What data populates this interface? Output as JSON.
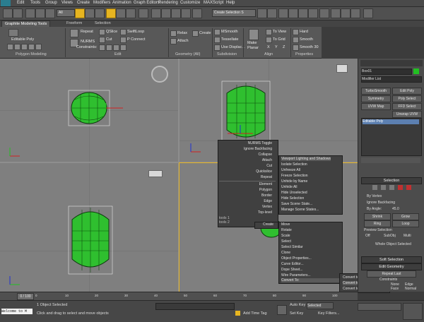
{
  "menu": [
    "Edit",
    "Tools",
    "Group",
    "Views",
    "Create",
    "Modifiers",
    "Animation",
    "Graph Editors",
    "Rendering",
    "Customize",
    "MAXScript",
    "Help"
  ],
  "toolbar": {
    "selection_set": "Create Selection S",
    "view_select": "All"
  },
  "ribbon": {
    "tabs": [
      "Graphite Modeling Tools",
      "Freeform",
      "Selection"
    ],
    "polymod": {
      "label": "Editable Poly",
      "group": "Polygon Modeling"
    },
    "edit": {
      "items": [
        "Repeat",
        "NURMS",
        "QSlice",
        "Cut",
        "SwiftLoop",
        "P Connect"
      ],
      "constraints_label": "Constraints:",
      "group": "Edit"
    },
    "geometry": {
      "items": [
        "Relax",
        "Attach",
        "Create"
      ],
      "group": "Geometry (All)"
    },
    "subdiv": {
      "items": [
        "MSmooth",
        "Tessellate",
        "Use Displac..."
      ],
      "group": "Subdivision"
    },
    "align": {
      "make_planar": "Make Planar",
      "items": [
        "To View",
        "To Grid"
      ],
      "xyz": [
        "X",
        "Y",
        "Z"
      ],
      "group": "Align"
    },
    "props": {
      "items": [
        "Hard",
        "Smooth",
        "Smooth 30"
      ],
      "group": "Properties"
    }
  },
  "quad": {
    "left_top": [
      "NURMS Toggle",
      "Ignore Backfacing",
      "Collapse",
      "Attach",
      "Cut",
      "Quickslice",
      "Repeat"
    ],
    "left_bottom": [
      "Element",
      "Polygon",
      "Border",
      "Edge",
      "Vertex",
      "Top-level"
    ],
    "left_tags": [
      "tools 1",
      "tools 2"
    ],
    "right_top": [
      "Viewport Lighting and Shadows",
      "Isolate Selection",
      "Unfreeze All",
      "Freeze Selection",
      "Unhide by Name",
      "Unhide All",
      "Hide Unselected",
      "Hide Selection",
      "Save Scene State...",
      "Manage Scene States..."
    ],
    "create_label": "Create",
    "right_bottom": [
      "Move",
      "Rotate",
      "Scale",
      "Select",
      "Select Similar",
      "Clone",
      "Object Properties...",
      "Curve Editor...",
      "Dope Sheet...",
      "Wire Parameters...",
      "Convert To:"
    ],
    "convert": [
      "Convert to Editable Mesh",
      "Convert to Editable Poly",
      "Convert to Editable Patch"
    ]
  },
  "cmd": {
    "object_name": "Box01",
    "modifier_list": "Modifier List",
    "buttons": [
      "TurboSmooth",
      "Edit Poly",
      "Symmetry",
      "Poly Select",
      "UVW Map",
      "FFD Select",
      "Unwrap UVW"
    ],
    "stack_item": "Editable Poly",
    "selection_head": "Selection",
    "by_vertex": "By Vertex",
    "ignore_backfacing": "Ignore Backfacing",
    "by_angle": "By Angle:",
    "angle_value": "45.0",
    "shrink": "Shrink",
    "grow": "Grow",
    "ring": "Ring",
    "loop": "Loop",
    "preview_label": "Preview Selection",
    "preview_opts": [
      "Off",
      "SubObj",
      "Multi"
    ],
    "whole_object": "Whole Object Selected",
    "soft_selection": "Soft Selection",
    "edit_geometry": "Edit Geometry",
    "repeat_last": "Repeat Last",
    "constraints": "Constraints",
    "none": "None",
    "edge": "Edge",
    "face": "Face",
    "normal": "Normal"
  },
  "timeline": {
    "frame": "0 / 100",
    "ticks": [
      "0",
      "10",
      "20",
      "30",
      "40",
      "50",
      "60",
      "70",
      "80",
      "90",
      "100"
    ]
  },
  "status": {
    "script_listener": "Welcome to M",
    "selected": "1 Object Selected",
    "prompt": "Click and drag to select and move objects",
    "add_time_tag": "Add Time Tag",
    "auto_key": "Auto Key",
    "selected_btn": "Selected",
    "set_key": "Set Key",
    "key_filters": "Key Filters..."
  },
  "colors": {
    "accent": "#e7b520",
    "object_green": "#2fbf2f",
    "selection_box": "#f0b84a"
  }
}
